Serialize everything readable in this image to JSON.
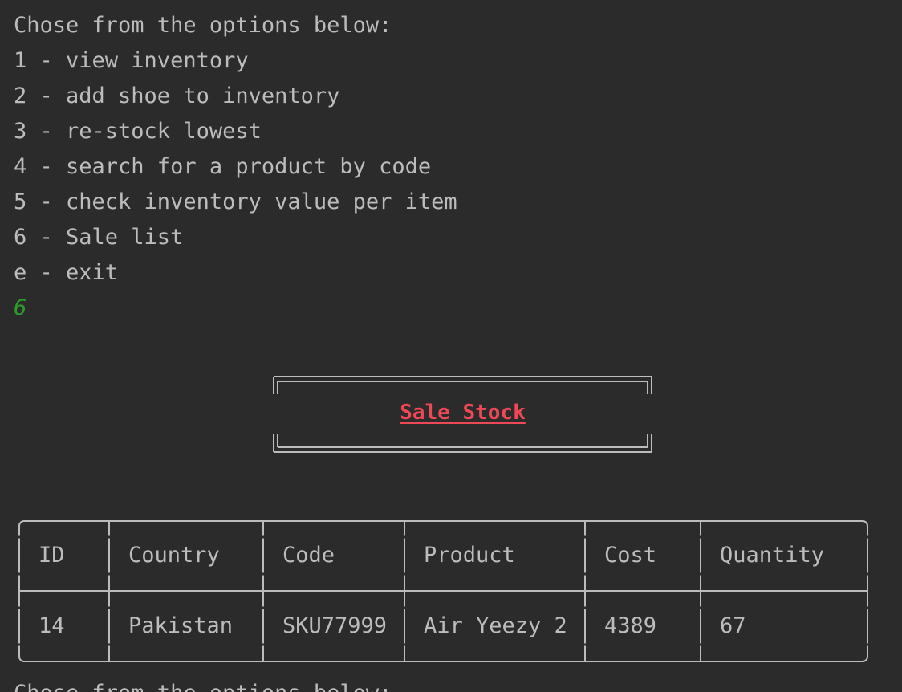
{
  "menu": {
    "prompt": "Chose from the options below:",
    "options": [
      "1 - view inventory",
      "2 - add shoe to inventory",
      "3 - re-stock lowest",
      "4 - search for a product by code",
      "5 - check inventory value per item",
      "6 - Sale list",
      "e - exit"
    ],
    "user_input": "6"
  },
  "banner": {
    "title": "Sale Stock",
    "title_color": "#ee4857"
  },
  "table": {
    "headers": [
      "ID",
      "Country",
      "Code",
      "Product",
      "Cost",
      "Quantity"
    ],
    "rows": [
      [
        "14",
        "Pakistan",
        "SKU77999",
        "Air Yeezy 2",
        "4389",
        "67"
      ]
    ]
  },
  "next_prompt": "Chose from the options below:",
  "colors": {
    "background": "#2b2b2b",
    "text": "#bcbcbc",
    "input_echo": "#2e9d2e"
  }
}
